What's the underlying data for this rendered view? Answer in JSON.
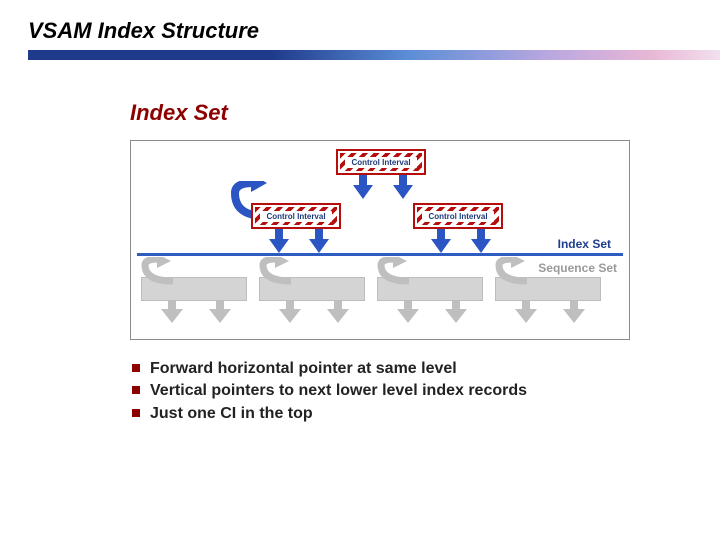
{
  "page_title": "VSAM Index Structure",
  "section_title": "Index Set",
  "diagram": {
    "ci_label": "Control Interval",
    "index_set_label": "Index Set",
    "sequence_set_label": "Sequence Set",
    "colors": {
      "ci_border": "#b60d0d",
      "arrow_blue": "#2b55c2",
      "divider": "#2e5cc0",
      "seq_gray": "#d4d4d4",
      "title_underline_start": "#1e3a8a"
    }
  },
  "bullets": [
    "Forward horizontal pointer at same level",
    "Vertical pointers to next lower level index records",
    "Just one CI in the top"
  ]
}
